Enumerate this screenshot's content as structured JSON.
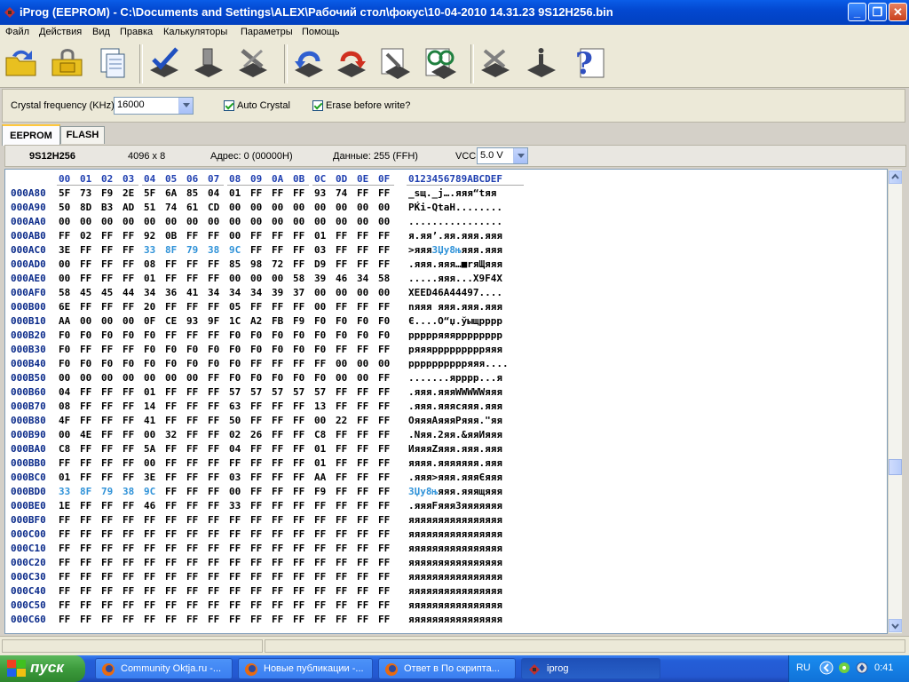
{
  "window": {
    "title": "iProg (EEPROM) - C:\\Documents and Settings\\ALEX\\Рабочий стол\\фокус\\10-04-2010  14.31.23  9S12H256.bin",
    "minimize": "_",
    "maximize": "❐",
    "close": "✕"
  },
  "menu": [
    "Файл",
    "Действия",
    "Вид",
    "Правка",
    "Калькуляторы",
    "Параметры",
    "Помощь"
  ],
  "toolbar_icons": [
    "open-folder-icon",
    "save-lock-icon",
    "copy-documents-icon",
    "verify-chip-icon",
    "read-chip-icon",
    "write-chip-icon",
    "undo-chip-icon",
    "redo-chip-icon",
    "chip-settings-icon",
    "find-chip-icon",
    "erase-chip-icon",
    "program-chip-icon",
    "help-icon"
  ],
  "options": {
    "crystal_label": "Crystal frequency (KHz)",
    "crystal_value": "16000",
    "auto_crystal_label": "Auto Crystal",
    "auto_crystal_checked": true,
    "erase_label": "Erase before write?",
    "erase_checked": true
  },
  "tabs": [
    {
      "label": "EEPROM",
      "active": true
    },
    {
      "label": "FLASH",
      "active": false
    }
  ],
  "info": {
    "chip": "9S12H256",
    "size": "4096 x 8",
    "address": "Адрес: 0 (00000H)",
    "data": "Данные: 255 (FFH)",
    "vcc_label": "VCC",
    "vcc_value": "5.0 V"
  },
  "hex": {
    "columns": [
      "00",
      "01",
      "02",
      "03",
      "04",
      "05",
      "06",
      "07",
      "08",
      "09",
      "0A",
      "0B",
      "0C",
      "0D",
      "0E",
      "0F"
    ],
    "ascii_header": "0123456789ABCDEF",
    "highlight_color": "#2f92d8",
    "rows": [
      {
        "addr": "000A80",
        "bytes": [
          "5F",
          "73",
          "F9",
          "2E",
          "5F",
          "6A",
          "85",
          "04",
          "01",
          "FF",
          "FF",
          "FF",
          "93",
          "74",
          "FF",
          "FF"
        ],
        "ascii": "_sщ._j….яяя“tяя"
      },
      {
        "addr": "000A90",
        "bytes": [
          "50",
          "8D",
          "B3",
          "AD",
          "51",
          "74",
          "61",
          "CD",
          "00",
          "00",
          "00",
          "00",
          "00",
          "00",
          "00",
          "00"
        ],
        "ascii": "PЌі-QtaН........"
      },
      {
        "addr": "000AA0",
        "bytes": [
          "00",
          "00",
          "00",
          "00",
          "00",
          "00",
          "00",
          "00",
          "00",
          "00",
          "00",
          "00",
          "00",
          "00",
          "00",
          "00"
        ],
        "ascii": "................"
      },
      {
        "addr": "000AB0",
        "bytes": [
          "FF",
          "02",
          "FF",
          "FF",
          "92",
          "0B",
          "FF",
          "FF",
          "00",
          "FF",
          "FF",
          "FF",
          "01",
          "FF",
          "FF",
          "FF"
        ],
        "ascii": "я.яя’.яя.яяя.яяя"
      },
      {
        "addr": "000AC0",
        "bytes": [
          "3E",
          "FF",
          "FF",
          "FF",
          "33",
          "8F",
          "79",
          "38",
          "9C",
          "FF",
          "FF",
          "FF",
          "03",
          "FF",
          "FF",
          "FF"
        ],
        "ascii": ">яяя3Џy8њяяя.яяя",
        "hl": [
          4,
          5,
          6,
          7,
          8
        ],
        "ascii_hl": [
          4,
          8
        ]
      },
      {
        "addr": "000AD0",
        "bytes": [
          "00",
          "FF",
          "FF",
          "FF",
          "08",
          "FF",
          "FF",
          "FF",
          "85",
          "98",
          "72",
          "FF",
          "D9",
          "FF",
          "FF",
          "FF"
        ],
        "ascii": ".яяя.яяя…■rяЩяяя"
      },
      {
        "addr": "000AE0",
        "bytes": [
          "00",
          "FF",
          "FF",
          "FF",
          "01",
          "FF",
          "FF",
          "FF",
          "00",
          "00",
          "00",
          "58",
          "39",
          "46",
          "34",
          "58"
        ],
        "ascii": ".....яяя...X9F4X"
      },
      {
        "addr": "000AF0",
        "bytes": [
          "58",
          "45",
          "45",
          "44",
          "34",
          "36",
          "41",
          "34",
          "34",
          "34",
          "39",
          "37",
          "00",
          "00",
          "00",
          "00"
        ],
        "ascii": "XEED46A44497...."
      },
      {
        "addr": "000B00",
        "bytes": [
          "6E",
          "FF",
          "FF",
          "FF",
          "20",
          "FF",
          "FF",
          "FF",
          "05",
          "FF",
          "FF",
          "FF",
          "00",
          "FF",
          "FF",
          "FF"
        ],
        "ascii": "nяяя яяя.яяя.яяя"
      },
      {
        "addr": "000B10",
        "bytes": [
          "AA",
          "00",
          "00",
          "00",
          "0F",
          "CE",
          "93",
          "9F",
          "1C",
          "A2",
          "FB",
          "F9",
          "F0",
          "F0",
          "F0",
          "F0"
        ],
        "ascii": "Є....О“џ.ўыщpppp"
      },
      {
        "addr": "000B20",
        "bytes": [
          "F0",
          "F0",
          "F0",
          "F0",
          "F0",
          "FF",
          "FF",
          "FF",
          "F0",
          "F0",
          "F0",
          "F0",
          "F0",
          "F0",
          "F0",
          "F0"
        ],
        "ascii": "pppppяяяpppppppp"
      },
      {
        "addr": "000B30",
        "bytes": [
          "F0",
          "FF",
          "FF",
          "FF",
          "F0",
          "F0",
          "F0",
          "F0",
          "F0",
          "F0",
          "F0",
          "F0",
          "F0",
          "FF",
          "FF",
          "FF"
        ],
        "ascii": "pяяяpppppppppяяя"
      },
      {
        "addr": "000B40",
        "bytes": [
          "F0",
          "F0",
          "F0",
          "F0",
          "F0",
          "F0",
          "F0",
          "F0",
          "F0",
          "FF",
          "FF",
          "FF",
          "FF",
          "00",
          "00",
          "00"
        ],
        "ascii": "ppppppppppяяя...."
      },
      {
        "addr": "000B50",
        "bytes": [
          "00",
          "00",
          "00",
          "00",
          "00",
          "00",
          "00",
          "FF",
          "F0",
          "F0",
          "F0",
          "F0",
          "F0",
          "00",
          "00",
          "FF"
        ],
        "ascii": ".......яpppp...я"
      },
      {
        "addr": "000B60",
        "bytes": [
          "04",
          "FF",
          "FF",
          "FF",
          "01",
          "FF",
          "FF",
          "FF",
          "57",
          "57",
          "57",
          "57",
          "57",
          "FF",
          "FF",
          "FF"
        ],
        "ascii": ".яяя.яяяWWWWWяяя"
      },
      {
        "addr": "000B70",
        "bytes": [
          "08",
          "FF",
          "FF",
          "FF",
          "14",
          "FF",
          "FF",
          "FF",
          "63",
          "FF",
          "FF",
          "FF",
          "13",
          "FF",
          "FF",
          "FF"
        ],
        "ascii": ".яяя.яяяcяяя.яяя"
      },
      {
        "addr": "000B80",
        "bytes": [
          "4F",
          "FF",
          "FF",
          "FF",
          "41",
          "FF",
          "FF",
          "FF",
          "50",
          "FF",
          "FF",
          "FF",
          "00",
          "22",
          "FF",
          "FF"
        ],
        "ascii": "OяяяAяяяPяяя.\"яя"
      },
      {
        "addr": "000B90",
        "bytes": [
          "00",
          "4E",
          "FF",
          "FF",
          "00",
          "32",
          "FF",
          "FF",
          "02",
          "26",
          "FF",
          "FF",
          "C8",
          "FF",
          "FF",
          "FF"
        ],
        "ascii": ".Nяя.2яя.&яяИяяя"
      },
      {
        "addr": "000BA0",
        "bytes": [
          "C8",
          "FF",
          "FF",
          "FF",
          "5A",
          "FF",
          "FF",
          "FF",
          "04",
          "FF",
          "FF",
          "FF",
          "01",
          "FF",
          "FF",
          "FF"
        ],
        "ascii": "ИяяяZяяя.яяя.яяя"
      },
      {
        "addr": "000BB0",
        "bytes": [
          "FF",
          "FF",
          "FF",
          "FF",
          "00",
          "FF",
          "FF",
          "FF",
          "FF",
          "FF",
          "FF",
          "FF",
          "01",
          "FF",
          "FF",
          "FF"
        ],
        "ascii": "яяяя.яяяяяяя.яяя"
      },
      {
        "addr": "000BC0",
        "bytes": [
          "01",
          "FF",
          "FF",
          "FF",
          "3E",
          "FF",
          "FF",
          "FF",
          "03",
          "FF",
          "FF",
          "FF",
          "AA",
          "FF",
          "FF",
          "FF"
        ],
        "ascii": ".яяя>яяя.яяяЄяяя"
      },
      {
        "addr": "000BD0",
        "bytes": [
          "33",
          "8F",
          "79",
          "38",
          "9C",
          "FF",
          "FF",
          "FF",
          "00",
          "FF",
          "FF",
          "FF",
          "F9",
          "FF",
          "FF",
          "FF"
        ],
        "ascii": "3Џy8њяяя.яяящяяя",
        "hl": [
          0,
          1,
          2,
          3,
          4
        ],
        "ascii_hl": [
          0,
          4
        ]
      },
      {
        "addr": "000BE0",
        "bytes": [
          "1E",
          "FF",
          "FF",
          "FF",
          "46",
          "FF",
          "FF",
          "FF",
          "33",
          "FF",
          "FF",
          "FF",
          "FF",
          "FF",
          "FF",
          "FF"
        ],
        "ascii": ".яяяFяяя3яяяяяяя"
      },
      {
        "addr": "000BF0",
        "bytes": [
          "FF",
          "FF",
          "FF",
          "FF",
          "FF",
          "FF",
          "FF",
          "FF",
          "FF",
          "FF",
          "FF",
          "FF",
          "FF",
          "FF",
          "FF",
          "FF"
        ],
        "ascii": "яяяяяяяяяяяяяяяя"
      },
      {
        "addr": "000C00",
        "bytes": [
          "FF",
          "FF",
          "FF",
          "FF",
          "FF",
          "FF",
          "FF",
          "FF",
          "FF",
          "FF",
          "FF",
          "FF",
          "FF",
          "FF",
          "FF",
          "FF"
        ],
        "ascii": "яяяяяяяяяяяяяяяя"
      },
      {
        "addr": "000C10",
        "bytes": [
          "FF",
          "FF",
          "FF",
          "FF",
          "FF",
          "FF",
          "FF",
          "FF",
          "FF",
          "FF",
          "FF",
          "FF",
          "FF",
          "FF",
          "FF",
          "FF"
        ],
        "ascii": "яяяяяяяяяяяяяяяя"
      },
      {
        "addr": "000C20",
        "bytes": [
          "FF",
          "FF",
          "FF",
          "FF",
          "FF",
          "FF",
          "FF",
          "FF",
          "FF",
          "FF",
          "FF",
          "FF",
          "FF",
          "FF",
          "FF",
          "FF"
        ],
        "ascii": "яяяяяяяяяяяяяяяя"
      },
      {
        "addr": "000C30",
        "bytes": [
          "FF",
          "FF",
          "FF",
          "FF",
          "FF",
          "FF",
          "FF",
          "FF",
          "FF",
          "FF",
          "FF",
          "FF",
          "FF",
          "FF",
          "FF",
          "FF"
        ],
        "ascii": "яяяяяяяяяяяяяяяя"
      },
      {
        "addr": "000C40",
        "bytes": [
          "FF",
          "FF",
          "FF",
          "FF",
          "FF",
          "FF",
          "FF",
          "FF",
          "FF",
          "FF",
          "FF",
          "FF",
          "FF",
          "FF",
          "FF",
          "FF"
        ],
        "ascii": "яяяяяяяяяяяяяяяя"
      },
      {
        "addr": "000C50",
        "bytes": [
          "FF",
          "FF",
          "FF",
          "FF",
          "FF",
          "FF",
          "FF",
          "FF",
          "FF",
          "FF",
          "FF",
          "FF",
          "FF",
          "FF",
          "FF",
          "FF"
        ],
        "ascii": "яяяяяяяяяяяяяяяя"
      },
      {
        "addr": "000C60",
        "bytes": [
          "FF",
          "FF",
          "FF",
          "FF",
          "FF",
          "FF",
          "FF",
          "FF",
          "FF",
          "FF",
          "FF",
          "FF",
          "FF",
          "FF",
          "FF",
          "FF"
        ],
        "ascii": "яяяяяяяяяяяяяяяя"
      }
    ]
  },
  "taskbar": {
    "start_label": "пуск",
    "tasks": [
      {
        "label": "Community Oktja.ru -...",
        "icon": "firefox-icon",
        "active": false
      },
      {
        "label": "Новые публикации -...",
        "icon": "firefox-icon",
        "active": false
      },
      {
        "label": "Ответ в По скрипта...",
        "icon": "firefox-icon",
        "active": false
      },
      {
        "label": "iprog",
        "icon": "iprog-icon",
        "active": true
      }
    ],
    "lang": "RU",
    "clock": "0:41"
  }
}
